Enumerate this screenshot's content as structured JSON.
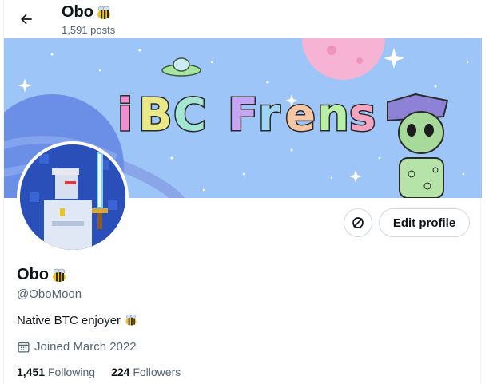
{
  "header": {
    "name": "Obo",
    "posts": "1,591 posts"
  },
  "banner": {
    "title_text": "iBC Frens",
    "colors": {
      "sky": "#9ec5f7",
      "planet": "#f7b3d3",
      "ring_planet": "#6b8fe6"
    }
  },
  "profile": {
    "name": "Obo",
    "handle": "@OboMoon",
    "bio": "Native BTC enjoyer",
    "joined": "Joined March 2022",
    "following_count": "1,451",
    "following_label": "Following",
    "followers_count": "224",
    "followers_label": "Followers"
  },
  "actions": {
    "edit_profile": "Edit profile",
    "icon": "no-ai-icon"
  },
  "icons": {
    "back": "arrow-left-icon",
    "bee": "bee-emoji-icon",
    "calendar": "calendar-icon"
  }
}
